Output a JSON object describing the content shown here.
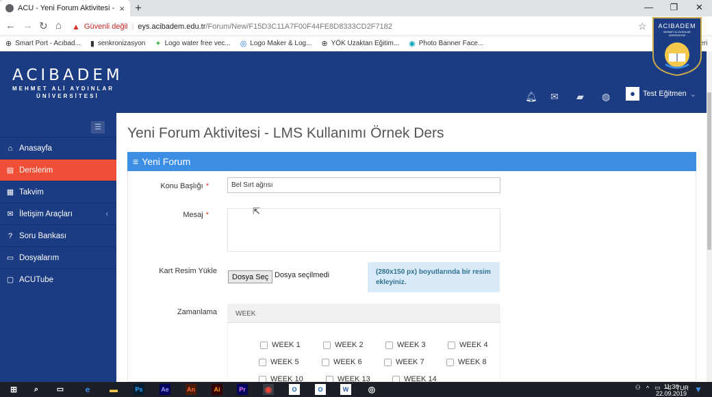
{
  "browser": {
    "tab_title": "ACU - Yeni Forum Aktivitesi - ACU",
    "tab_close": "×",
    "new_tab": "+",
    "security_label": "Güvenli değil",
    "url_host": "eys.acibadem.edu.tr",
    "url_path": "/Forum/New/F15D3C11A7F00F44FE8D8333CD2F7182",
    "bookmarks": [
      {
        "icon": "⊕",
        "label": "Smart Port - Acıbad..."
      },
      {
        "icon": "▮",
        "label": "senkronizasyon"
      },
      {
        "icon": "✦",
        "label": "Logo water free vec..."
      },
      {
        "icon": "◎",
        "label": "Logo Maker & Log..."
      },
      {
        "icon": "⊕",
        "label": "YÖK Uzaktan Eğitim..."
      },
      {
        "icon": "◉",
        "label": "Photo Banner Face..."
      }
    ],
    "bookmarks_overflow": "leri"
  },
  "corner_logo": {
    "line1": "ACIBADEM",
    "line2": "MEHMET ALİ AYDINLAR",
    "line3": "ÜNİVERSİTESİ"
  },
  "header": {
    "brand": "ACIBADEM",
    "brand_line2": "MEHMET ALİ AYDINLAR",
    "brand_line3": "ÜNİVERSİTESİ",
    "user_name": "Test Eğitmen"
  },
  "sidebar": {
    "toggle": "☰",
    "items": [
      {
        "icon": "⌂",
        "label": "Anasayfa",
        "active": false
      },
      {
        "icon": "▤",
        "label": "Derslerim",
        "active": true
      },
      {
        "icon": "▦",
        "label": "Takvim",
        "active": false
      },
      {
        "icon": "✉",
        "label": "İletişim Araçları",
        "active": false,
        "arrow": "‹"
      },
      {
        "icon": "?",
        "label": "Soru Bankası",
        "active": false
      },
      {
        "icon": "▭",
        "label": "Dosyalarım",
        "active": false
      },
      {
        "icon": "▢",
        "label": "ACUTube",
        "active": false
      }
    ]
  },
  "main": {
    "page_title": "Yeni Forum Aktivitesi - LMS Kullanımı Örnek Ders",
    "panel_title": "Yeni Forum",
    "panel_icon": "≡",
    "form": {
      "subject_label": "Konu Başlığı",
      "subject_value": "Bel Sırt ağrısı",
      "message_label": "Mesaj",
      "required_mark": "*",
      "card_image_label": "Kart Resim Yükle",
      "file_button": "Dosya Seç",
      "file_status": "Dosya seçilmedi",
      "image_hint": "(280x150 px) boyutlarında bir resim ekleyiniz.",
      "schedule_label": "Zamanlama",
      "schedule_header": "WEEK",
      "weeks": [
        "WEEK 1",
        "WEEK 2",
        "WEEK 3",
        "WEEK 4",
        "WEEK 5",
        "WEEK 6",
        "WEEK 7",
        "WEEK 8",
        "WEEK 10",
        "WEEK 13",
        "WEEK 14"
      ]
    }
  },
  "taskbar": {
    "apps": [
      "Ps",
      "Ae",
      "An",
      "Ai",
      "Pr"
    ],
    "language": "TUR",
    "time": "11:30",
    "date": "22.09.2019"
  },
  "colors": {
    "header_blue": "#1b3c82",
    "active_red": "#f04e37",
    "panel_blue": "#3d8fe6",
    "hint_bg": "#d9ebf8"
  }
}
